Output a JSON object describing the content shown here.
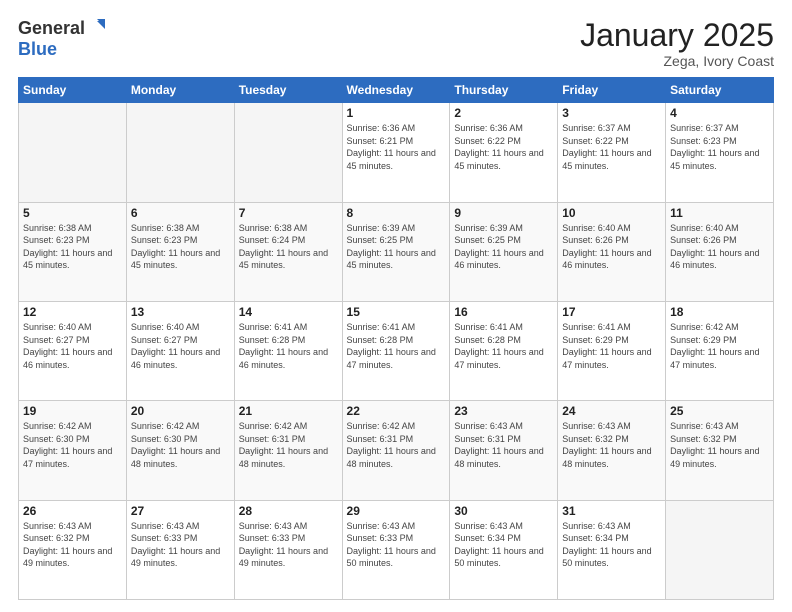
{
  "logo": {
    "general": "General",
    "blue": "Blue"
  },
  "header": {
    "month": "January 2025",
    "location": "Zega, Ivory Coast"
  },
  "weekdays": [
    "Sunday",
    "Monday",
    "Tuesday",
    "Wednesday",
    "Thursday",
    "Friday",
    "Saturday"
  ],
  "weeks": [
    [
      {
        "day": null,
        "info": null
      },
      {
        "day": null,
        "info": null
      },
      {
        "day": null,
        "info": null
      },
      {
        "day": "1",
        "info": "Sunrise: 6:36 AM\nSunset: 6:21 PM\nDaylight: 11 hours and 45 minutes."
      },
      {
        "day": "2",
        "info": "Sunrise: 6:36 AM\nSunset: 6:22 PM\nDaylight: 11 hours and 45 minutes."
      },
      {
        "day": "3",
        "info": "Sunrise: 6:37 AM\nSunset: 6:22 PM\nDaylight: 11 hours and 45 minutes."
      },
      {
        "day": "4",
        "info": "Sunrise: 6:37 AM\nSunset: 6:23 PM\nDaylight: 11 hours and 45 minutes."
      }
    ],
    [
      {
        "day": "5",
        "info": "Sunrise: 6:38 AM\nSunset: 6:23 PM\nDaylight: 11 hours and 45 minutes."
      },
      {
        "day": "6",
        "info": "Sunrise: 6:38 AM\nSunset: 6:23 PM\nDaylight: 11 hours and 45 minutes."
      },
      {
        "day": "7",
        "info": "Sunrise: 6:38 AM\nSunset: 6:24 PM\nDaylight: 11 hours and 45 minutes."
      },
      {
        "day": "8",
        "info": "Sunrise: 6:39 AM\nSunset: 6:25 PM\nDaylight: 11 hours and 45 minutes."
      },
      {
        "day": "9",
        "info": "Sunrise: 6:39 AM\nSunset: 6:25 PM\nDaylight: 11 hours and 46 minutes."
      },
      {
        "day": "10",
        "info": "Sunrise: 6:40 AM\nSunset: 6:26 PM\nDaylight: 11 hours and 46 minutes."
      },
      {
        "day": "11",
        "info": "Sunrise: 6:40 AM\nSunset: 6:26 PM\nDaylight: 11 hours and 46 minutes."
      }
    ],
    [
      {
        "day": "12",
        "info": "Sunrise: 6:40 AM\nSunset: 6:27 PM\nDaylight: 11 hours and 46 minutes."
      },
      {
        "day": "13",
        "info": "Sunrise: 6:40 AM\nSunset: 6:27 PM\nDaylight: 11 hours and 46 minutes."
      },
      {
        "day": "14",
        "info": "Sunrise: 6:41 AM\nSunset: 6:28 PM\nDaylight: 11 hours and 46 minutes."
      },
      {
        "day": "15",
        "info": "Sunrise: 6:41 AM\nSunset: 6:28 PM\nDaylight: 11 hours and 47 minutes."
      },
      {
        "day": "16",
        "info": "Sunrise: 6:41 AM\nSunset: 6:28 PM\nDaylight: 11 hours and 47 minutes."
      },
      {
        "day": "17",
        "info": "Sunrise: 6:41 AM\nSunset: 6:29 PM\nDaylight: 11 hours and 47 minutes."
      },
      {
        "day": "18",
        "info": "Sunrise: 6:42 AM\nSunset: 6:29 PM\nDaylight: 11 hours and 47 minutes."
      }
    ],
    [
      {
        "day": "19",
        "info": "Sunrise: 6:42 AM\nSunset: 6:30 PM\nDaylight: 11 hours and 47 minutes."
      },
      {
        "day": "20",
        "info": "Sunrise: 6:42 AM\nSunset: 6:30 PM\nDaylight: 11 hours and 48 minutes."
      },
      {
        "day": "21",
        "info": "Sunrise: 6:42 AM\nSunset: 6:31 PM\nDaylight: 11 hours and 48 minutes."
      },
      {
        "day": "22",
        "info": "Sunrise: 6:42 AM\nSunset: 6:31 PM\nDaylight: 11 hours and 48 minutes."
      },
      {
        "day": "23",
        "info": "Sunrise: 6:43 AM\nSunset: 6:31 PM\nDaylight: 11 hours and 48 minutes."
      },
      {
        "day": "24",
        "info": "Sunrise: 6:43 AM\nSunset: 6:32 PM\nDaylight: 11 hours and 48 minutes."
      },
      {
        "day": "25",
        "info": "Sunrise: 6:43 AM\nSunset: 6:32 PM\nDaylight: 11 hours and 49 minutes."
      }
    ],
    [
      {
        "day": "26",
        "info": "Sunrise: 6:43 AM\nSunset: 6:32 PM\nDaylight: 11 hours and 49 minutes."
      },
      {
        "day": "27",
        "info": "Sunrise: 6:43 AM\nSunset: 6:33 PM\nDaylight: 11 hours and 49 minutes."
      },
      {
        "day": "28",
        "info": "Sunrise: 6:43 AM\nSunset: 6:33 PM\nDaylight: 11 hours and 49 minutes."
      },
      {
        "day": "29",
        "info": "Sunrise: 6:43 AM\nSunset: 6:33 PM\nDaylight: 11 hours and 50 minutes."
      },
      {
        "day": "30",
        "info": "Sunrise: 6:43 AM\nSunset: 6:34 PM\nDaylight: 11 hours and 50 minutes."
      },
      {
        "day": "31",
        "info": "Sunrise: 6:43 AM\nSunset: 6:34 PM\nDaylight: 11 hours and 50 minutes."
      },
      {
        "day": null,
        "info": null
      }
    ]
  ]
}
